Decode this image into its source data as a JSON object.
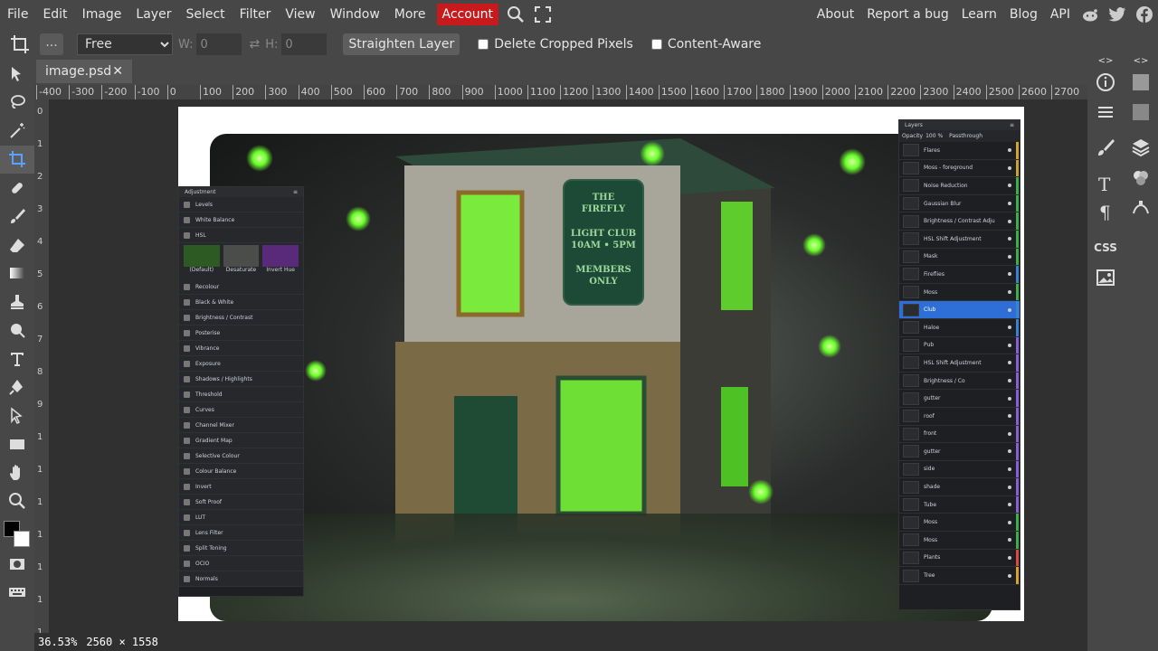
{
  "menu": {
    "items": [
      "File",
      "Edit",
      "Image",
      "Layer",
      "Select",
      "Filter",
      "View",
      "Window",
      "More"
    ],
    "account": "Account",
    "right_links": [
      "About",
      "Report a bug",
      "Learn",
      "Blog",
      "API"
    ]
  },
  "options": {
    "mode_value": "Free",
    "w_label": "W:",
    "w_value": "0",
    "h_label": "H:",
    "h_value": "0",
    "straighten_label": "Straighten Layer",
    "delete_cropped_label": "Delete Cropped Pixels",
    "content_aware_label": "Content-Aware"
  },
  "document": {
    "tab_name": "image.psd"
  },
  "ruler": {
    "top_ticks": [
      "-400",
      "-300",
      "-200",
      "-100",
      "0",
      "100",
      "200",
      "300",
      "400",
      "500",
      "600",
      "700",
      "800",
      "900",
      "1000",
      "1100",
      "1200",
      "1300",
      "1400",
      "1500",
      "1600",
      "1700",
      "1800",
      "1900",
      "2000",
      "2100",
      "2200",
      "2300",
      "2400",
      "2500",
      "2600",
      "2700"
    ],
    "left_ticks": [
      "0",
      "1",
      "2",
      "3",
      "4",
      "5",
      "6",
      "7",
      "8",
      "9",
      "1",
      "1",
      "1",
      "1",
      "1",
      "1",
      "1"
    ]
  },
  "sign": {
    "line1": "THE",
    "line2": "FIREFLY",
    "line3": "LIGHT CLUB",
    "line4": "10AM • 5PM",
    "line5": "MEMBERS",
    "line6": "ONLY"
  },
  "adjustment_panel": {
    "title": "Adjustment",
    "items_top": [
      "Levels",
      "White Balance",
      "HSL"
    ],
    "presets": [
      "(Default)",
      "Desaturate",
      "Invert Hue"
    ],
    "items": [
      "Recolour",
      "Black & White",
      "Brightness / Contrast",
      "Posterise",
      "Vibrance",
      "Exposure",
      "Shadows / Highlights",
      "Threshold",
      "Curves",
      "Channel Mixer",
      "Gradient Map",
      "Selective Colour",
      "Colour Balance",
      "Invert",
      "Soft Proof",
      "LUT",
      "Lens Filter",
      "Split Toning",
      "OCIO",
      "Normals"
    ]
  },
  "layers_panel": {
    "title": "Layers",
    "opacity_label": "Opacity",
    "opacity_value": "100 %",
    "blend_mode": "Passthrough",
    "layers": [
      "Flares",
      "Moss - foreground",
      "Noise Reduction",
      "Gaussian Blur",
      "Brightness / Contrast Adju",
      "HSL Shift Adjustment",
      "Mask",
      "Fireflies",
      "Moss",
      "Club",
      "Haloe",
      "Pub",
      "HSL Shift Adjustment",
      "Brightness / Co",
      "gutter",
      "roof",
      "front",
      "gutter",
      "side",
      "shade",
      "Tube",
      "Moss",
      "Moss",
      "Plants",
      "Tree"
    ],
    "selected_layer": "Club"
  },
  "status": {
    "zoom": "36.53%",
    "size": "2560 × 1558"
  },
  "colors": {
    "accent_red": "#c8191d",
    "selection_blue": "#2d6fd6",
    "firefly_green": "#6aff2a"
  }
}
